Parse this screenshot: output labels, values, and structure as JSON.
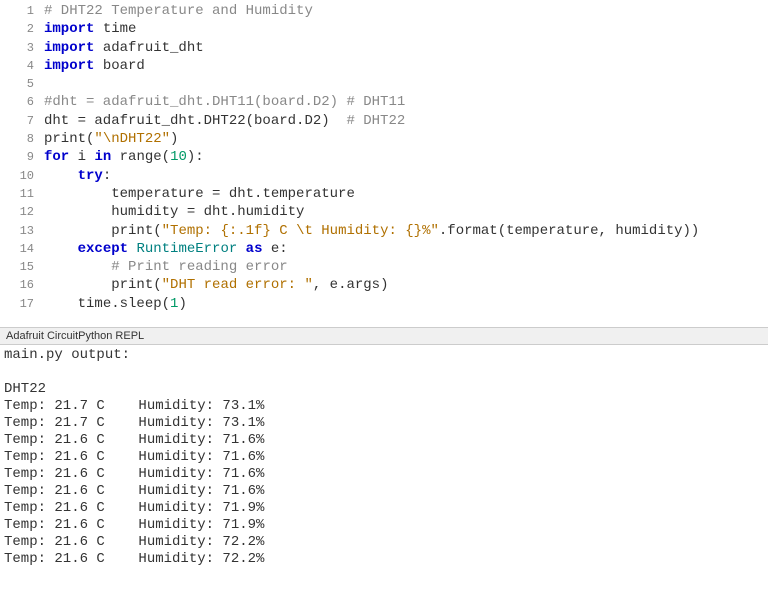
{
  "editor": {
    "lines": [
      {
        "num": 1,
        "tokens": [
          {
            "t": "# DHT22 Temperature and Humidity",
            "c": "cm"
          }
        ]
      },
      {
        "num": 2,
        "tokens": [
          {
            "t": "import",
            "c": "kw"
          },
          {
            "t": " time",
            "c": ""
          }
        ]
      },
      {
        "num": 3,
        "tokens": [
          {
            "t": "import",
            "c": "kw"
          },
          {
            "t": " adafruit_dht",
            "c": ""
          }
        ]
      },
      {
        "num": 4,
        "tokens": [
          {
            "t": "import",
            "c": "kw"
          },
          {
            "t": " board",
            "c": ""
          }
        ]
      },
      {
        "num": 5,
        "tokens": []
      },
      {
        "num": 6,
        "tokens": [
          {
            "t": "#dht = adafruit_dht.DHT11(board.D2) # DHT11",
            "c": "cm"
          }
        ]
      },
      {
        "num": 7,
        "tokens": [
          {
            "t": "dht = adafruit_dht.DHT22(board.D2)  ",
            "c": ""
          },
          {
            "t": "# DHT22",
            "c": "cm"
          }
        ]
      },
      {
        "num": 8,
        "tokens": [
          {
            "t": "print",
            "c": ""
          },
          {
            "t": "(",
            "c": ""
          },
          {
            "t": "\"\\nDHT22\"",
            "c": "str"
          },
          {
            "t": ")",
            "c": ""
          }
        ]
      },
      {
        "num": 9,
        "tokens": [
          {
            "t": "for",
            "c": "kw"
          },
          {
            "t": " i ",
            "c": ""
          },
          {
            "t": "in",
            "c": "kw"
          },
          {
            "t": " ",
            "c": ""
          },
          {
            "t": "range",
            "c": ""
          },
          {
            "t": "(",
            "c": ""
          },
          {
            "t": "10",
            "c": "num"
          },
          {
            "t": "):",
            "c": ""
          }
        ]
      },
      {
        "num": 10,
        "indent": 1,
        "tokens": [
          {
            "t": "try",
            "c": "kw"
          },
          {
            "t": ":",
            "c": ""
          }
        ]
      },
      {
        "num": 11,
        "indent": 2,
        "tokens": [
          {
            "t": "temperature = dht.temperature",
            "c": ""
          }
        ]
      },
      {
        "num": 12,
        "indent": 2,
        "tokens": [
          {
            "t": "humidity = dht.humidity",
            "c": ""
          }
        ]
      },
      {
        "num": 13,
        "indent": 2,
        "tokens": [
          {
            "t": "print",
            "c": ""
          },
          {
            "t": "(",
            "c": ""
          },
          {
            "t": "\"Temp: {:.1f} C \\t Humidity: {}%\"",
            "c": "str"
          },
          {
            "t": ".format(temperature, humidity))",
            "c": ""
          }
        ]
      },
      {
        "num": 14,
        "indent": 1,
        "tokens": [
          {
            "t": "except",
            "c": "kw"
          },
          {
            "t": " ",
            "c": ""
          },
          {
            "t": "RuntimeError",
            "c": "exc"
          },
          {
            "t": " ",
            "c": ""
          },
          {
            "t": "as",
            "c": "kw"
          },
          {
            "t": " e:",
            "c": ""
          }
        ]
      },
      {
        "num": 15,
        "indent": 2,
        "tokens": [
          {
            "t": "# Print reading error",
            "c": "cm"
          }
        ]
      },
      {
        "num": 16,
        "indent": 2,
        "tokens": [
          {
            "t": "print",
            "c": ""
          },
          {
            "t": "(",
            "c": ""
          },
          {
            "t": "\"DHT read error: \"",
            "c": "str"
          },
          {
            "t": ", e.args)",
            "c": ""
          }
        ]
      },
      {
        "num": 17,
        "indent": 1,
        "tokens": [
          {
            "t": "time.sleep(",
            "c": ""
          },
          {
            "t": "1",
            "c": "num"
          },
          {
            "t": ")",
            "c": ""
          }
        ]
      }
    ]
  },
  "repl": {
    "title": "Adafruit CircuitPython REPL",
    "lines": [
      "main.py output:",
      "",
      "DHT22",
      "Temp: 21.7 C    Humidity: 73.1%",
      "Temp: 21.7 C    Humidity: 73.1%",
      "Temp: 21.6 C    Humidity: 71.6%",
      "Temp: 21.6 C    Humidity: 71.6%",
      "Temp: 21.6 C    Humidity: 71.6%",
      "Temp: 21.6 C    Humidity: 71.6%",
      "Temp: 21.6 C    Humidity: 71.9%",
      "Temp: 21.6 C    Humidity: 71.9%",
      "Temp: 21.6 C    Humidity: 72.2%",
      "Temp: 21.6 C    Humidity: 72.2%"
    ]
  }
}
